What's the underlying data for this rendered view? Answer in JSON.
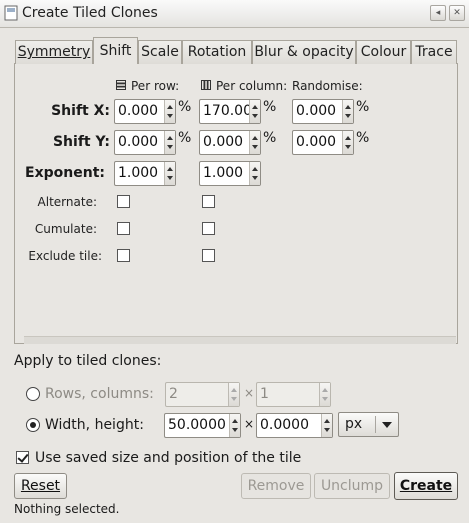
{
  "window": {
    "title": "Create Tiled Clones",
    "title_buttons": [
      "◂",
      "✕"
    ]
  },
  "tabs": [
    {
      "label": "Symmetry",
      "mnemonic_index": 0
    },
    {
      "label": "Shift",
      "mnemonic_index": 1,
      "active": true
    },
    {
      "label": "Scale",
      "mnemonic_index": 2
    },
    {
      "label": "Rotation",
      "mnemonic_index": 0
    },
    {
      "label": "Blur & opacity",
      "mnemonic_index": 0
    },
    {
      "label": "Colour",
      "mnemonic_index": 0
    },
    {
      "label": "Trace",
      "mnemonic_index": 0
    }
  ],
  "shift": {
    "col_per_row": "Per row:",
    "col_per_column": "Per column:",
    "col_randomise": "Randomise:",
    "shift_x_label": "Shift X:",
    "shift_y_label": "Shift Y:",
    "exponent_label": "Exponent:",
    "alternate_label": "Alternate:",
    "cumulate_label": "Cumulate:",
    "exclude_tile_label": "Exclude tile:",
    "percent": "%",
    "shift_x": {
      "per_row": "0.000",
      "per_column": "170.00",
      "randomise": "0.000"
    },
    "shift_y": {
      "per_row": "0.000",
      "per_column": "0.000",
      "randomise": "0.000"
    },
    "exponent": {
      "per_row": "1.000",
      "per_column": "1.000"
    },
    "alternate": {
      "per_row": false,
      "per_column": false
    },
    "cumulate": {
      "per_row": false,
      "per_column": false
    },
    "exclude_tile": {
      "per_row": false,
      "per_column": false
    }
  },
  "apply": {
    "heading": "Apply to tiled clones:",
    "rows_columns_label": "Rows, columns:",
    "rows": "2",
    "columns": "1",
    "times": "×",
    "width_height_label": "Width, height:",
    "width": "50.0000",
    "height": "0.0000",
    "unit": "px",
    "selected_mode": "width_height"
  },
  "use_saved": {
    "label": "Use saved size and position of the tile",
    "checked": true
  },
  "buttons": {
    "reset": "Reset",
    "remove": "Remove",
    "unclump": "Unclump",
    "create": "Create"
  },
  "status": "Nothing selected."
}
